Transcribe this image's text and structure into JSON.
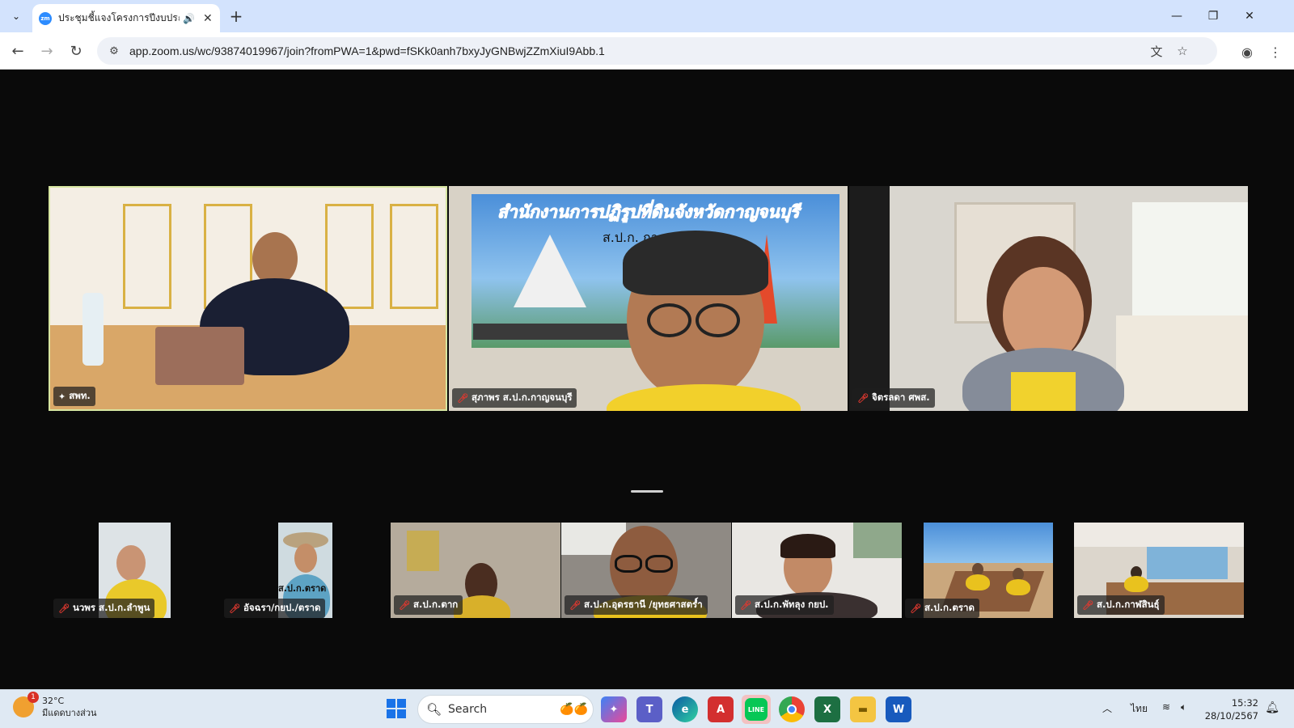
{
  "browser": {
    "tab_title": "ประชุมชี้แจงโครงการปีงบประมาณ",
    "tab_favicon": "zm",
    "new_tab": "+",
    "url": "app.zoom.us/wc/93874019967/join?fromPWA=1&pwd=fSKk0anh7bxyJyGNBwjZZmXiuI9Abb.1"
  },
  "meeting": {
    "main_tiles": [
      {
        "name": "สพท.",
        "muted": false,
        "pinned": true
      },
      {
        "name": "สุภาพร ส.ป.ก.กาญจนบุรี",
        "muted": true
      },
      {
        "name": "จิตรลดา ศพส.",
        "muted": true
      }
    ],
    "gallery_tiles": [
      {
        "name": "นวพร ส.ป.ก.ลำพูน",
        "muted": true
      },
      {
        "name": "อัจฉรา/กยป./ตราด",
        "muted": true
      },
      {
        "name": "ส.ป.ก.ตาก",
        "muted": true
      },
      {
        "name": "ส.ป.ก.อุดรธานี /ยุทธศาสตร์ำ",
        "muted": true
      },
      {
        "name": "ส.ป.ก.พัทลุง กยป.",
        "muted": true
      },
      {
        "name": "ส.ป.ก.ตราด",
        "muted": true
      },
      {
        "name": "ส.ป.ก.กาฬสินธุ์",
        "muted": true
      }
    ],
    "banner_text": "สำนักงานการปฏิรูปที่ดินจังหวัดกาญจนบุรี",
    "banner_sub": "ส.ป.ก. กาญจนบุรี",
    "sign_text": "ส.ป.ก.ตราด"
  },
  "taskbar": {
    "weather_temp": "32°C",
    "weather_desc": "มีแดดบางส่วน",
    "weather_badge": "1",
    "search_placeholder": "Search",
    "language": "ไทย",
    "time": "15:32",
    "date": "28/10/2567"
  }
}
